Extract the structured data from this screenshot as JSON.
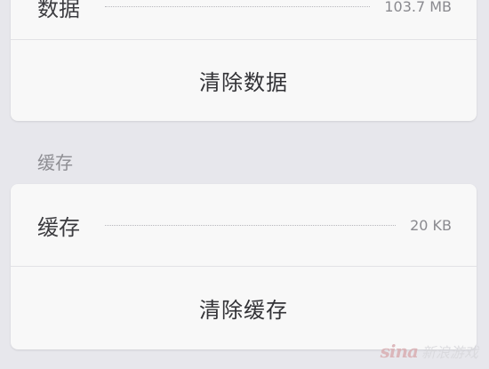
{
  "data_section": {
    "data_label": "数据",
    "data_size": "103.7 MB",
    "clear_data_label": "清除数据"
  },
  "cache_section": {
    "header": "缓存",
    "cache_label": "缓存",
    "cache_size": "20 KB",
    "clear_cache_label": "清除缓存"
  },
  "watermark": {
    "logo": "sina",
    "text": "新浪游戏"
  }
}
